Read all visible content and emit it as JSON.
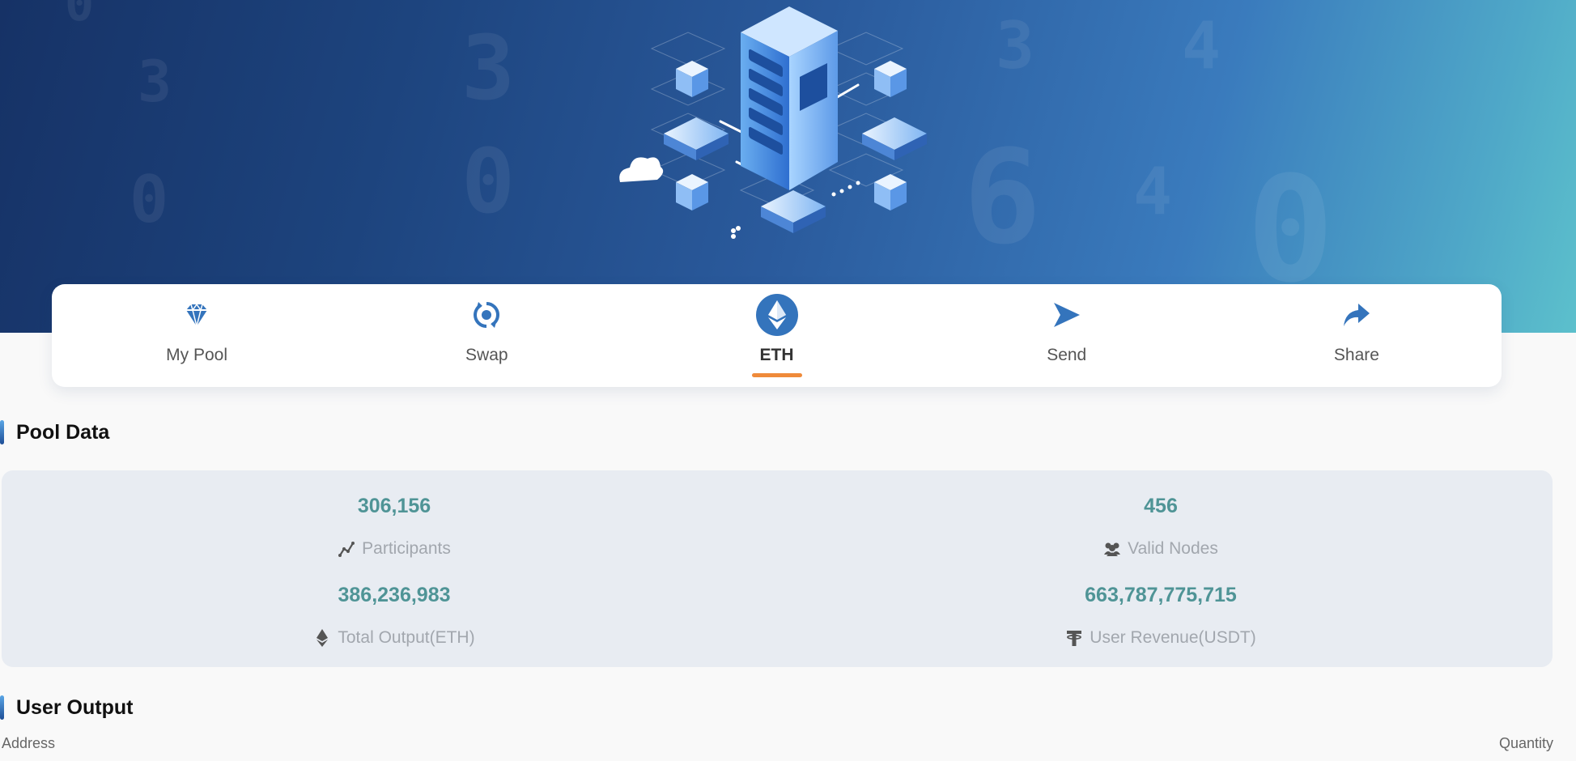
{
  "nav": {
    "items": [
      {
        "label": "My Pool",
        "icon": "diamond-icon"
      },
      {
        "label": "Swap",
        "icon": "swap-cycle-icon"
      },
      {
        "label": "ETH",
        "icon": "ethereum-icon",
        "active": true
      },
      {
        "label": "Send",
        "icon": "send-arrow-icon"
      },
      {
        "label": "Share",
        "icon": "share-arrow-icon"
      }
    ]
  },
  "pool_data": {
    "title": "Pool Data",
    "stats": [
      {
        "value": "306,156",
        "label": "Participants",
        "icon": "chart-line-icon"
      },
      {
        "value": "456",
        "label": "Valid Nodes",
        "icon": "users-icon"
      },
      {
        "value": "386,236,983",
        "label": "Total Output(ETH)",
        "icon": "ethereum-small-icon"
      },
      {
        "value": "663,787,775,715",
        "label": "User Revenue(USDT)",
        "icon": "tether-icon"
      }
    ]
  },
  "user_output": {
    "title": "User Output",
    "columns": [
      "Address",
      "Quantity"
    ]
  },
  "colors": {
    "accent_blue": "#3474bc",
    "stat_value": "#4f9496",
    "active_underline": "#ef8a3a"
  }
}
